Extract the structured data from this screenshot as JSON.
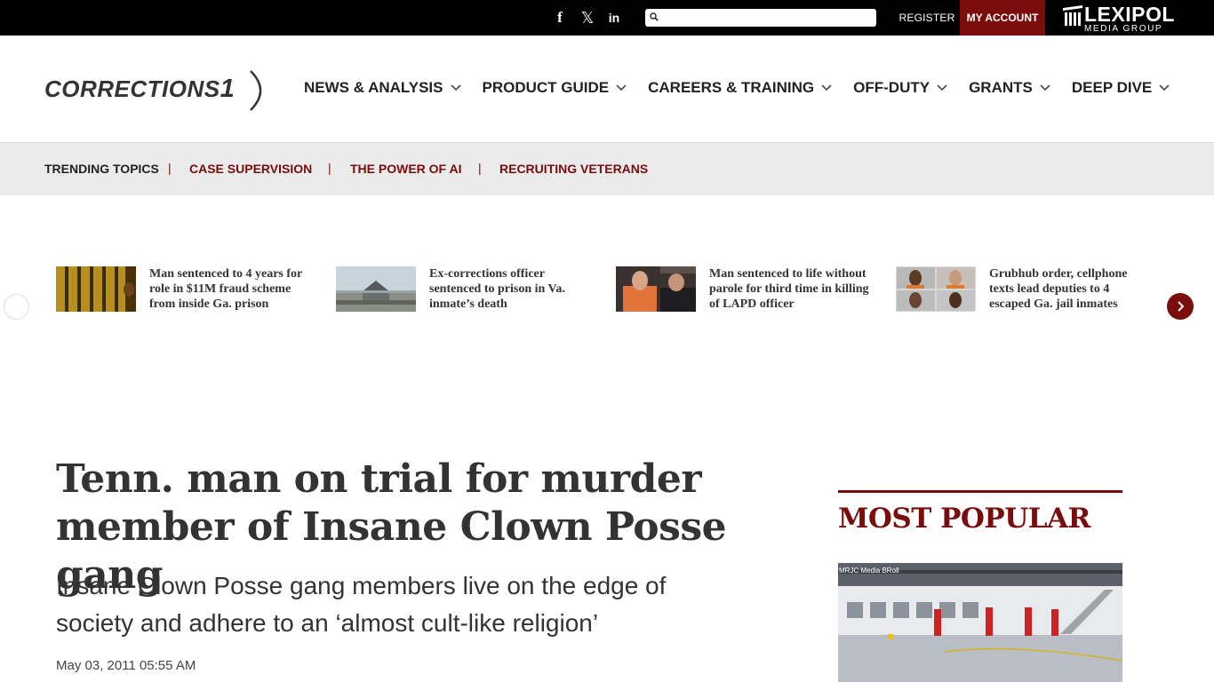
{
  "topbar": {
    "social": [
      {
        "name": "facebook-icon",
        "glyph": "f"
      },
      {
        "name": "x-icon",
        "glyph": "𝕏"
      },
      {
        "name": "linkedin-icon",
        "glyph": "in"
      }
    ],
    "search": {
      "value": "",
      "placeholder": ""
    },
    "register_label": "REGISTER",
    "my_account_label": "MY ACCOUNT",
    "brand": {
      "name": "LEXIPOL",
      "sub": "MEDIA GROUP"
    }
  },
  "header": {
    "logo": {
      "text": "CORRECTIONS",
      "number": "1"
    },
    "nav": [
      {
        "label": "NEWS & ANALYSIS"
      },
      {
        "label": "PRODUCT GUIDE"
      },
      {
        "label": "CAREERS & TRAINING"
      },
      {
        "label": "OFF-DUTY"
      },
      {
        "label": "GRANTS"
      },
      {
        "label": "DEEP DIVE"
      }
    ]
  },
  "trending": {
    "label": "TRENDING TOPICS",
    "separator": "|",
    "topics": [
      "CASE SUPERVISION",
      "THE POWER OF AI",
      "RECRUITING VETERANS"
    ]
  },
  "carousel": {
    "stories": [
      {
        "title": "Man sentenced to 4 years for role in $11M fraud scheme from inside Ga. prison"
      },
      {
        "title": "Ex-corrections officer sentenced to prison in Va. inmate’s death"
      },
      {
        "title": "Man sentenced to life without parole for third time in killing of LAPD officer"
      },
      {
        "title": "Grubhub order, cellphone texts lead deputies to 4 escaped Ga. jail inmates"
      }
    ]
  },
  "article": {
    "headline": "Tenn. man on trial for murder member of Insane Clown Posse gang",
    "dek": "Insane Clown Posse gang members live on the edge of society and adhere to an ‘almost cult-like religion’",
    "date": "May 03, 2011 05:55 AM"
  },
  "sidebar": {
    "most_popular_title": "MOST POPULAR",
    "image_caption": "MRJC Media BRoll"
  },
  "colors": {
    "accent": "#7a0c0c",
    "topbar": "#000000",
    "trending_bg": "#ebebeb",
    "text": "#333333"
  }
}
